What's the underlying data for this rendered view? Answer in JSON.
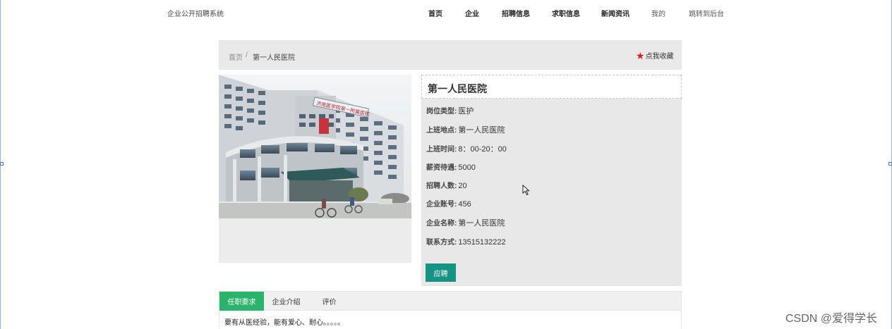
{
  "navbar": {
    "brand": "企业公开招聘系统",
    "items": [
      "首页",
      "企业",
      "招聘信息",
      "求职信息",
      "新闻资讯",
      "我的",
      "跳转到后台"
    ]
  },
  "breadcrumb": {
    "home": "首页",
    "separator": "/",
    "current": "第一人民医院",
    "favorite": "点我收藏"
  },
  "job": {
    "title": "第一人民医院",
    "fields": [
      {
        "label": "岗位类型:",
        "value": "医护"
      },
      {
        "label": "上班地点:",
        "value": "第一人民医院"
      },
      {
        "label": "上班时间:",
        "value": "8：00-20：00"
      },
      {
        "label": "薪资待遇:",
        "value": "5000"
      },
      {
        "label": "招聘人数:",
        "value": "20"
      },
      {
        "label": "企业账号:",
        "value": "456"
      },
      {
        "label": "企业名称:",
        "value": "第一人民医院"
      },
      {
        "label": "联系方式:",
        "value": "13515132222"
      }
    ],
    "apply_label": "应聘",
    "photo_sign": "济南医学院第一附属医院"
  },
  "tabs": {
    "items": [
      "任职要求",
      "企业介绍",
      "评价"
    ],
    "active": "任职要求",
    "content": "要有从医经验，能有爱心、耐心。。。。。"
  },
  "watermark": "CSDN @爱得学长",
  "colors": {
    "accent_green": "#2ab36a",
    "apply_teal": "#179384",
    "star_red": "#e8161b"
  }
}
